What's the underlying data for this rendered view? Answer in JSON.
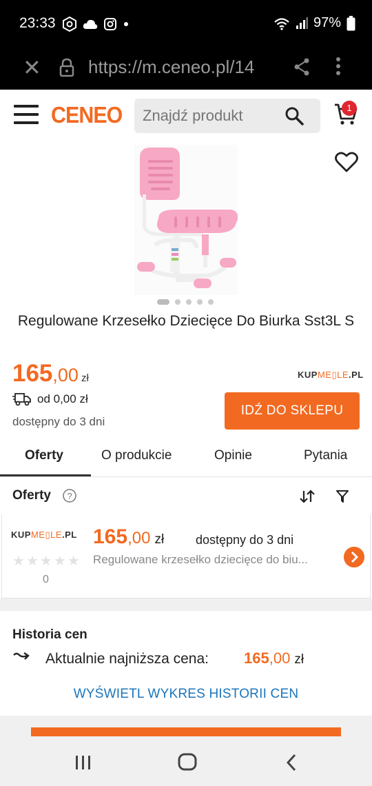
{
  "status": {
    "time": "23:33",
    "battery": "97%"
  },
  "browser": {
    "url": "https://m.ceneo.pl/14"
  },
  "header": {
    "logo": "CENEO",
    "search_placeholder": "Znajdź produkt",
    "cart_count": "1"
  },
  "product": {
    "title": "Regulowane Krzesełko Dziecięce Do Biurka Sst3L S",
    "price_int": "165",
    "price_dec": ",00",
    "currency": "zł",
    "shop_logo_left": "KUP",
    "shop_logo_mid": "ME▯LE",
    "shop_logo_right": ".PL",
    "delivery": "od 0,00 zł",
    "availability": "dostępny do 3 dni",
    "cta": "IDŹ DO SKLEPU"
  },
  "tabs": [
    "Oferty",
    "O produkcie",
    "Opinie",
    "Pytania"
  ],
  "offers": {
    "heading": "Oferty",
    "item": {
      "shop_left": "KUP",
      "shop_mid": "ME▯LE",
      "shop_right": ".PL",
      "price_int": "165",
      "price_dec": ",00",
      "currency": "zł",
      "availability": "dostępny do 3 dni",
      "description": "Regulowane krzesełko dziecięce do biu...",
      "reviews": "0"
    }
  },
  "history": {
    "title": "Historia cen",
    "label": "Aktualnie najniższa cena:",
    "price_int": "165",
    "price_dec": ",00",
    "currency": "zł",
    "link": "WYŚWIETL WYKRES HISTORII CEN"
  },
  "colors": {
    "accent": "#f26a21",
    "link": "#1b75bb",
    "badge": "#e0262e"
  }
}
